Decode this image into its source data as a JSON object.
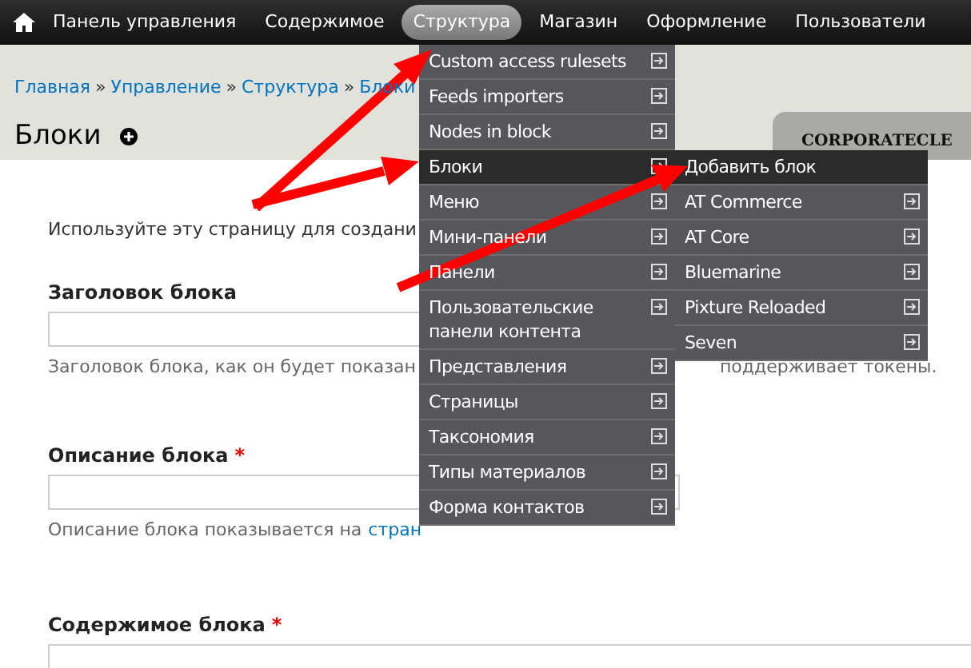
{
  "toolbar": {
    "items": [
      {
        "label": "Панель управления",
        "selected": false
      },
      {
        "label": "Содержимое",
        "selected": false
      },
      {
        "label": "Структура",
        "selected": true
      },
      {
        "label": "Магазин",
        "selected": false
      },
      {
        "label": "Оформление",
        "selected": false
      },
      {
        "label": "Пользователи",
        "selected": false
      }
    ]
  },
  "breadcrumbs": [
    {
      "label": "Главная"
    },
    {
      "separator": "»",
      "label": "Управление"
    },
    {
      "separator": "»",
      "label": "Структура"
    },
    {
      "separator": "»",
      "label": "Блоки"
    }
  ],
  "page_title": "Блоки",
  "theme_tab": "CORPORATECLE",
  "intro": "Используйте эту страницу для создани",
  "fields": [
    {
      "kind": "input",
      "label": "Заголовок блока",
      "help_left": "Заголовок блока, как он будет показан",
      "help_right": "поддерживает токены."
    },
    {
      "kind": "input",
      "label": "Описание блока",
      "required_mark": "*",
      "help_left": "Описание блока показывается на",
      "help_link": "стран"
    },
    {
      "kind": "textarea",
      "label": "Содержимое блока",
      "required_mark": "*"
    }
  ],
  "menu": {
    "items": [
      {
        "label": "Custom access rulesets",
        "selected": false,
        "submenu": true
      },
      {
        "label": "Feeds importers",
        "selected": false,
        "submenu": true
      },
      {
        "label": "Nodes in block",
        "selected": false,
        "submenu": true
      },
      {
        "label": "Блоки",
        "selected": true,
        "submenu": true
      },
      {
        "label": "Меню",
        "selected": false,
        "submenu": true
      },
      {
        "label": "Мини-панели",
        "selected": false,
        "submenu": true
      },
      {
        "label": "Панели",
        "selected": false,
        "submenu": true
      },
      {
        "label": "Пользовательские панели контента",
        "selected": false,
        "submenu": true
      },
      {
        "label": "Представления",
        "selected": false,
        "submenu": true
      },
      {
        "label": "Страницы",
        "selected": false,
        "submenu": true
      },
      {
        "label": "Таксономия",
        "selected": false,
        "submenu": true
      },
      {
        "label": "Типы материалов",
        "selected": false,
        "submenu": true
      },
      {
        "label": "Форма контактов",
        "selected": false,
        "submenu": true
      }
    ]
  },
  "submenu": {
    "items": [
      {
        "label": "Добавить блок",
        "selected": true,
        "submenu": false
      },
      {
        "label": "AT Commerce",
        "selected": false,
        "submenu": true
      },
      {
        "label": "AT Core",
        "selected": false,
        "submenu": true
      },
      {
        "label": "Bluemarine",
        "selected": false,
        "submenu": true
      },
      {
        "label": "Pixture Reloaded",
        "selected": false,
        "submenu": true
      },
      {
        "label": "Seven",
        "selected": false,
        "submenu": true
      }
    ]
  }
}
